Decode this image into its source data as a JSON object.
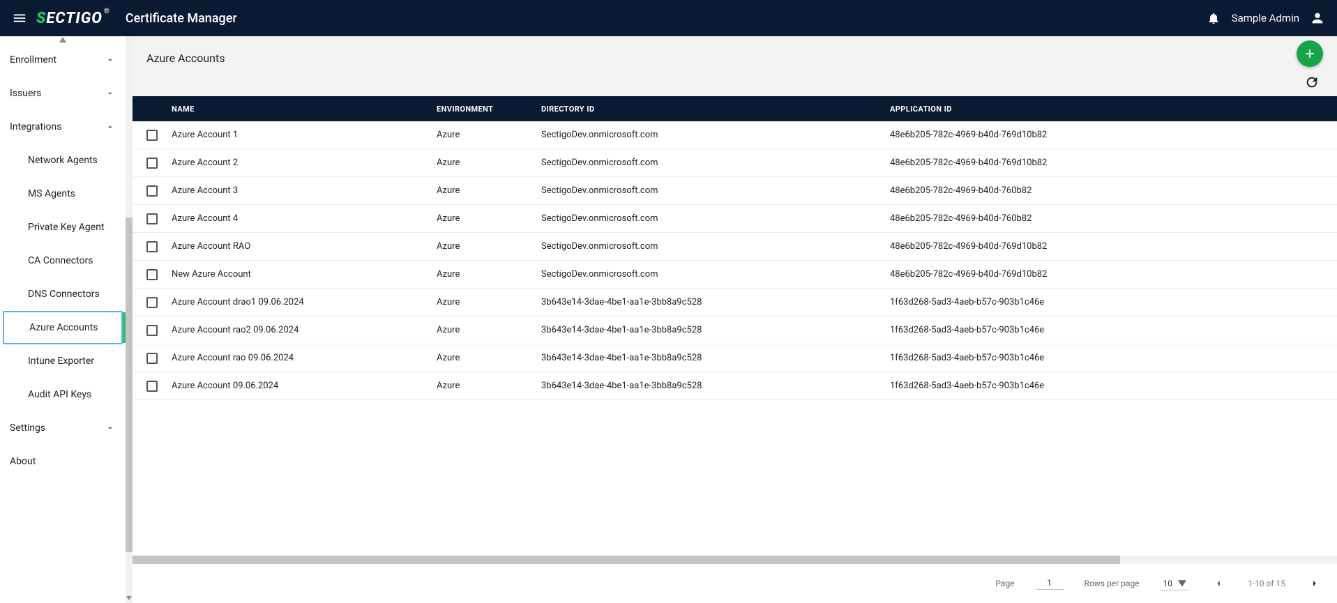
{
  "header": {
    "logo_prefix": "S",
    "logo_rest": "ECTIGO",
    "logo_reg": "®",
    "app_title": "Certificate Manager",
    "username": "Sample Admin"
  },
  "sidebar": {
    "sections": [
      {
        "label": "Enrollment",
        "expanded": false
      },
      {
        "label": "Issuers",
        "expanded": false
      },
      {
        "label": "Integrations",
        "expanded": true
      },
      {
        "label": "Settings",
        "expanded": false
      },
      {
        "label": "About",
        "expanded": false
      }
    ],
    "integrations_items": [
      {
        "label": "Network Agents"
      },
      {
        "label": "MS Agents"
      },
      {
        "label": "Private Key Agent"
      },
      {
        "label": "CA Connectors"
      },
      {
        "label": "DNS Connectors"
      },
      {
        "label": "Azure Accounts",
        "active": true
      },
      {
        "label": "Intune Exporter"
      },
      {
        "label": "Audit API Keys"
      }
    ]
  },
  "main": {
    "title": "Azure Accounts",
    "columns": {
      "name": "NAME",
      "env": "ENVIRONMENT",
      "dir": "DIRECTORY ID",
      "app": "APPLICATION ID"
    },
    "rows": [
      {
        "name": "Azure Account 1",
        "env": "Azure",
        "dir": "SectigoDev.onmicrosoft.com",
        "app": "48e6b205-782c-4969-b40d-769d10b82"
      },
      {
        "name": "Azure Account 2",
        "env": "Azure",
        "dir": "SectigoDev.onmicrosoft.com",
        "app": "48e6b205-782c-4969-b40d-769d10b82"
      },
      {
        "name": "Azure Account 3",
        "env": "Azure",
        "dir": "SectigoDev.onmicrosoft.com",
        "app": "48e6b205-782c-4969-b40d-760b82"
      },
      {
        "name": "Azure Account 4",
        "env": "Azure",
        "dir": "SectigoDev.onmicrosoft.com",
        "app": "48e6b205-782c-4969-b40d-760b82"
      },
      {
        "name": "Azure Account RAO",
        "env": "Azure",
        "dir": "SectigoDev.onmicrosoft.com",
        "app": "48e6b205-782c-4969-b40d-769d10b82"
      },
      {
        "name": "New Azure Account",
        "env": "Azure",
        "dir": "SectigoDev.onmicrosoft.com",
        "app": "48e6b205-782c-4969-b40d-769d10b82"
      },
      {
        "name": "Azure Account drao1 09.06.2024",
        "env": "Azure",
        "dir": "3b643e14-3dae-4be1-aa1e-3bb8a9c528",
        "app": "1f63d268-5ad3-4aeb-b57c-903b1c46e"
      },
      {
        "name": "Azure Account rao2 09.06.2024",
        "env": "Azure",
        "dir": "3b643e14-3dae-4be1-aa1e-3bb8a9c528",
        "app": "1f63d268-5ad3-4aeb-b57c-903b1c46e"
      },
      {
        "name": "Azure Account rao 09.06.2024",
        "env": "Azure",
        "dir": "3b643e14-3dae-4be1-aa1e-3bb8a9c528",
        "app": "1f63d268-5ad3-4aeb-b57c-903b1c46e"
      },
      {
        "name": "Azure Account 09.06.2024",
        "env": "Azure",
        "dir": "3b643e14-3dae-4be1-aa1e-3bb8a9c528",
        "app": "1f63d268-5ad3-4aeb-b57c-903b1c46e"
      }
    ]
  },
  "pager": {
    "page_label": "Page",
    "page_value": "1",
    "rpp_label": "Rows per page",
    "rpp_value": "10",
    "range": "1-10 of 15"
  }
}
